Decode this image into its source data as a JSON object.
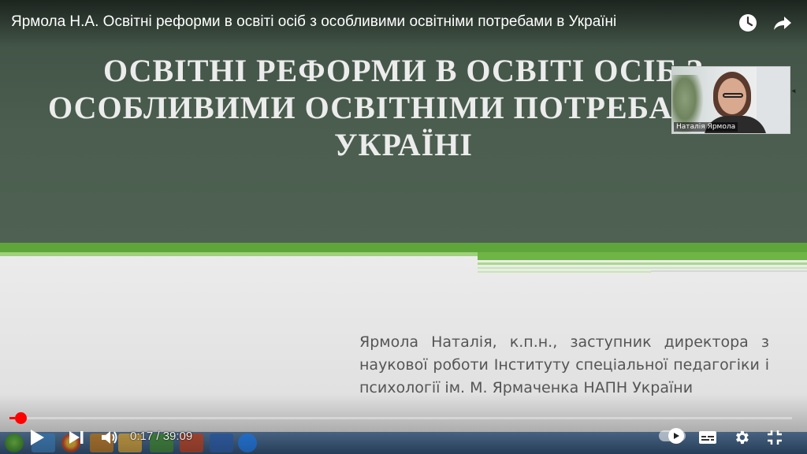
{
  "video": {
    "title": "Ярмола Н.А. Освітні реформи в освіті осіб з особливими освітніми потребами в Україні",
    "current_time": "0:17",
    "duration": "39:09",
    "time_display": "0:17 / 39:09",
    "progress_fraction": 0.0072,
    "autoplay_on": true
  },
  "slide": {
    "title_lines": [
      "ОСВІТНІ РЕФОРМИ В ОСВІТІ ОСІБ З",
      "ОСОБЛИВИМИ ОСВІТНІМИ ПОТРЕБАМИ В",
      "УКРАЇНІ"
    ],
    "subtitle": "Ярмола Наталія, к.п.н., заступник директора з наукової роботи Інституту спеціальної педагогіки і психології ім. М. Ярмаченка НАПН України"
  },
  "webcam": {
    "participant_name": "Наталія Ярмола"
  },
  "icons": {
    "watch_later": "clock-icon",
    "share": "share-arrow-icon",
    "play": "play-icon",
    "next": "skip-next-icon",
    "volume": "volume-icon",
    "captions": "captions-icon",
    "settings": "gear-icon",
    "fullscreen": "fullscreen-exit-icon"
  },
  "colors": {
    "progress": "#ff0000",
    "slide_header": "#4a5c4e",
    "slide_accent_green": "#5ea53a"
  }
}
